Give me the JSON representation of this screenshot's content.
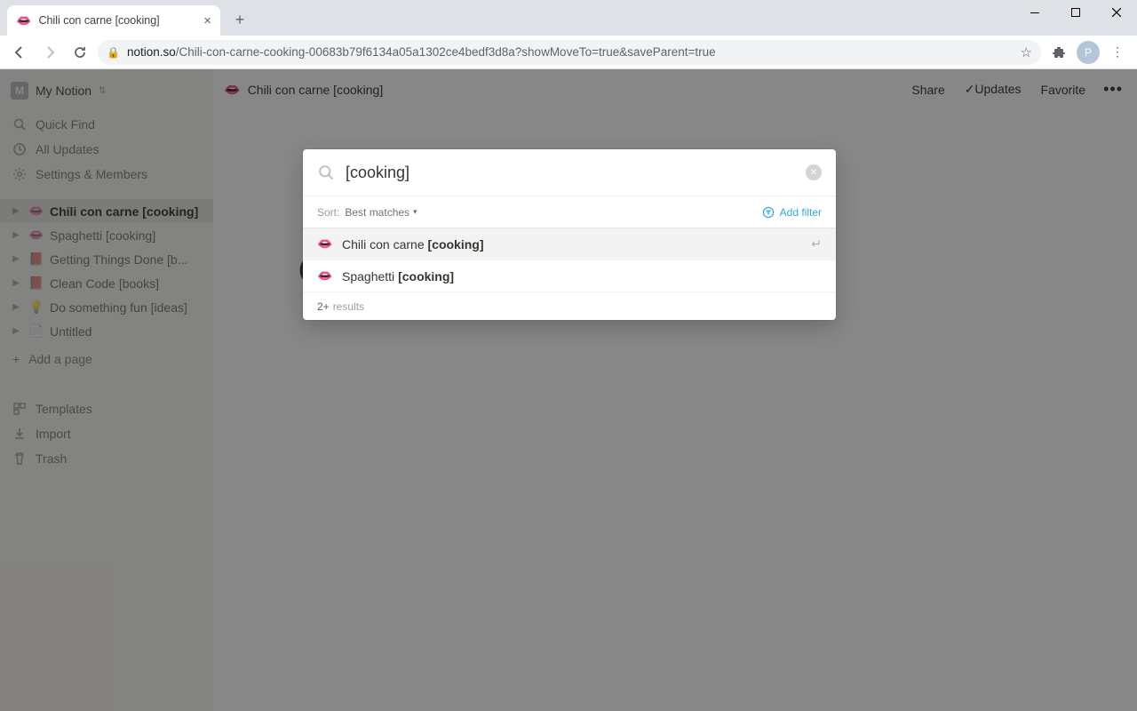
{
  "browser": {
    "tab_title": "Chili con carne [cooking]",
    "tab_favicon": "👄",
    "url_domain": "notion.so",
    "url_path": "/Chili-con-carne-cooking-00683b79f6134a05a1302ce4bedf3d8a?showMoveTo=true&saveParent=true",
    "avatar_initial": "P"
  },
  "workspace": {
    "name": "My Notion",
    "icon_initial": "M"
  },
  "sidebar": {
    "quick_find": "Quick Find",
    "all_updates": "All Updates",
    "settings": "Settings & Members",
    "pages": [
      {
        "emoji": "👄",
        "label": "Chili con carne [cooking]",
        "active": true
      },
      {
        "emoji": "👄",
        "label": "Spaghetti [cooking]",
        "active": false
      },
      {
        "emoji": "📕",
        "label": "Getting Things Done [b...",
        "active": false
      },
      {
        "emoji": "📕",
        "label": "Clean Code [books]",
        "active": false
      },
      {
        "emoji": "💡",
        "label": "Do something fun [ideas]",
        "active": false
      },
      {
        "emoji": "📄",
        "label": "Untitled",
        "active": false
      }
    ],
    "add_page": "Add a page",
    "templates": "Templates",
    "import": "Import",
    "trash": "Trash"
  },
  "topbar": {
    "breadcrumb_emoji": "👄",
    "breadcrumb_title": "Chili con carne [cooking]",
    "share": "Share",
    "updates": "Updates",
    "favorite": "Favorite"
  },
  "page": {
    "title": "Chili con carne [cooking]"
  },
  "search": {
    "query": "[cooking]",
    "sort_label": "Sort:",
    "sort_value": "Best matches",
    "add_filter": "Add filter",
    "results": [
      {
        "emoji": "👄",
        "text": "Chili con carne ",
        "highlight": "[cooking]",
        "selected": true
      },
      {
        "emoji": "👄",
        "text": "Spaghetti ",
        "highlight": "[cooking]",
        "selected": false
      }
    ],
    "result_count": "2+",
    "result_label": "results"
  }
}
